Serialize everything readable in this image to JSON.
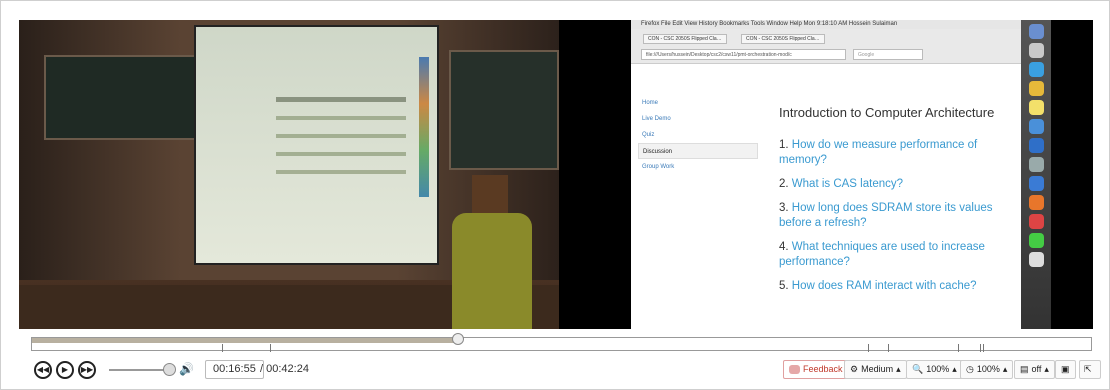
{
  "video": {
    "slide": {
      "menubar": "Firefox  File  Edit  View  History  Bookmarks  Tools  Window  Help        Mon 9:18:10 AM   Hossein Sulaiman",
      "tabs": [
        "CON - CSC 2050S Flipped Cla…",
        "CON - CSC 2050S Flipped Cla…"
      ],
      "url": "file:///Users/hussein/Desktop/csc2/csw11/pmt-orchestration-mod/c",
      "search_placeholder": "Google",
      "nav": [
        "Home",
        "Live Demo",
        "Quiz",
        "Discussion",
        "Group Work"
      ],
      "title": "Introduction to Computer Architecture",
      "items": [
        {
          "n": "1.",
          "text": "How do we measure performance of memory?"
        },
        {
          "n": "2.",
          "text": "What is CAS latency?"
        },
        {
          "n": "3.",
          "text": "How long does SDRAM store its values before a refresh?"
        },
        {
          "n": "4.",
          "text": "What techniques are used to increase performance?"
        },
        {
          "n": "5.",
          "text": "How does RAM interact with cache?"
        }
      ]
    }
  },
  "player": {
    "progress": 0.4,
    "current_time": "00:16:55",
    "duration": "/ 00:42:24",
    "volume": 0.9,
    "feedback_label": "Feedback",
    "quality_label": "Medium",
    "zoom_label": "100%",
    "speed_label": "100%",
    "captions_label": "off"
  }
}
